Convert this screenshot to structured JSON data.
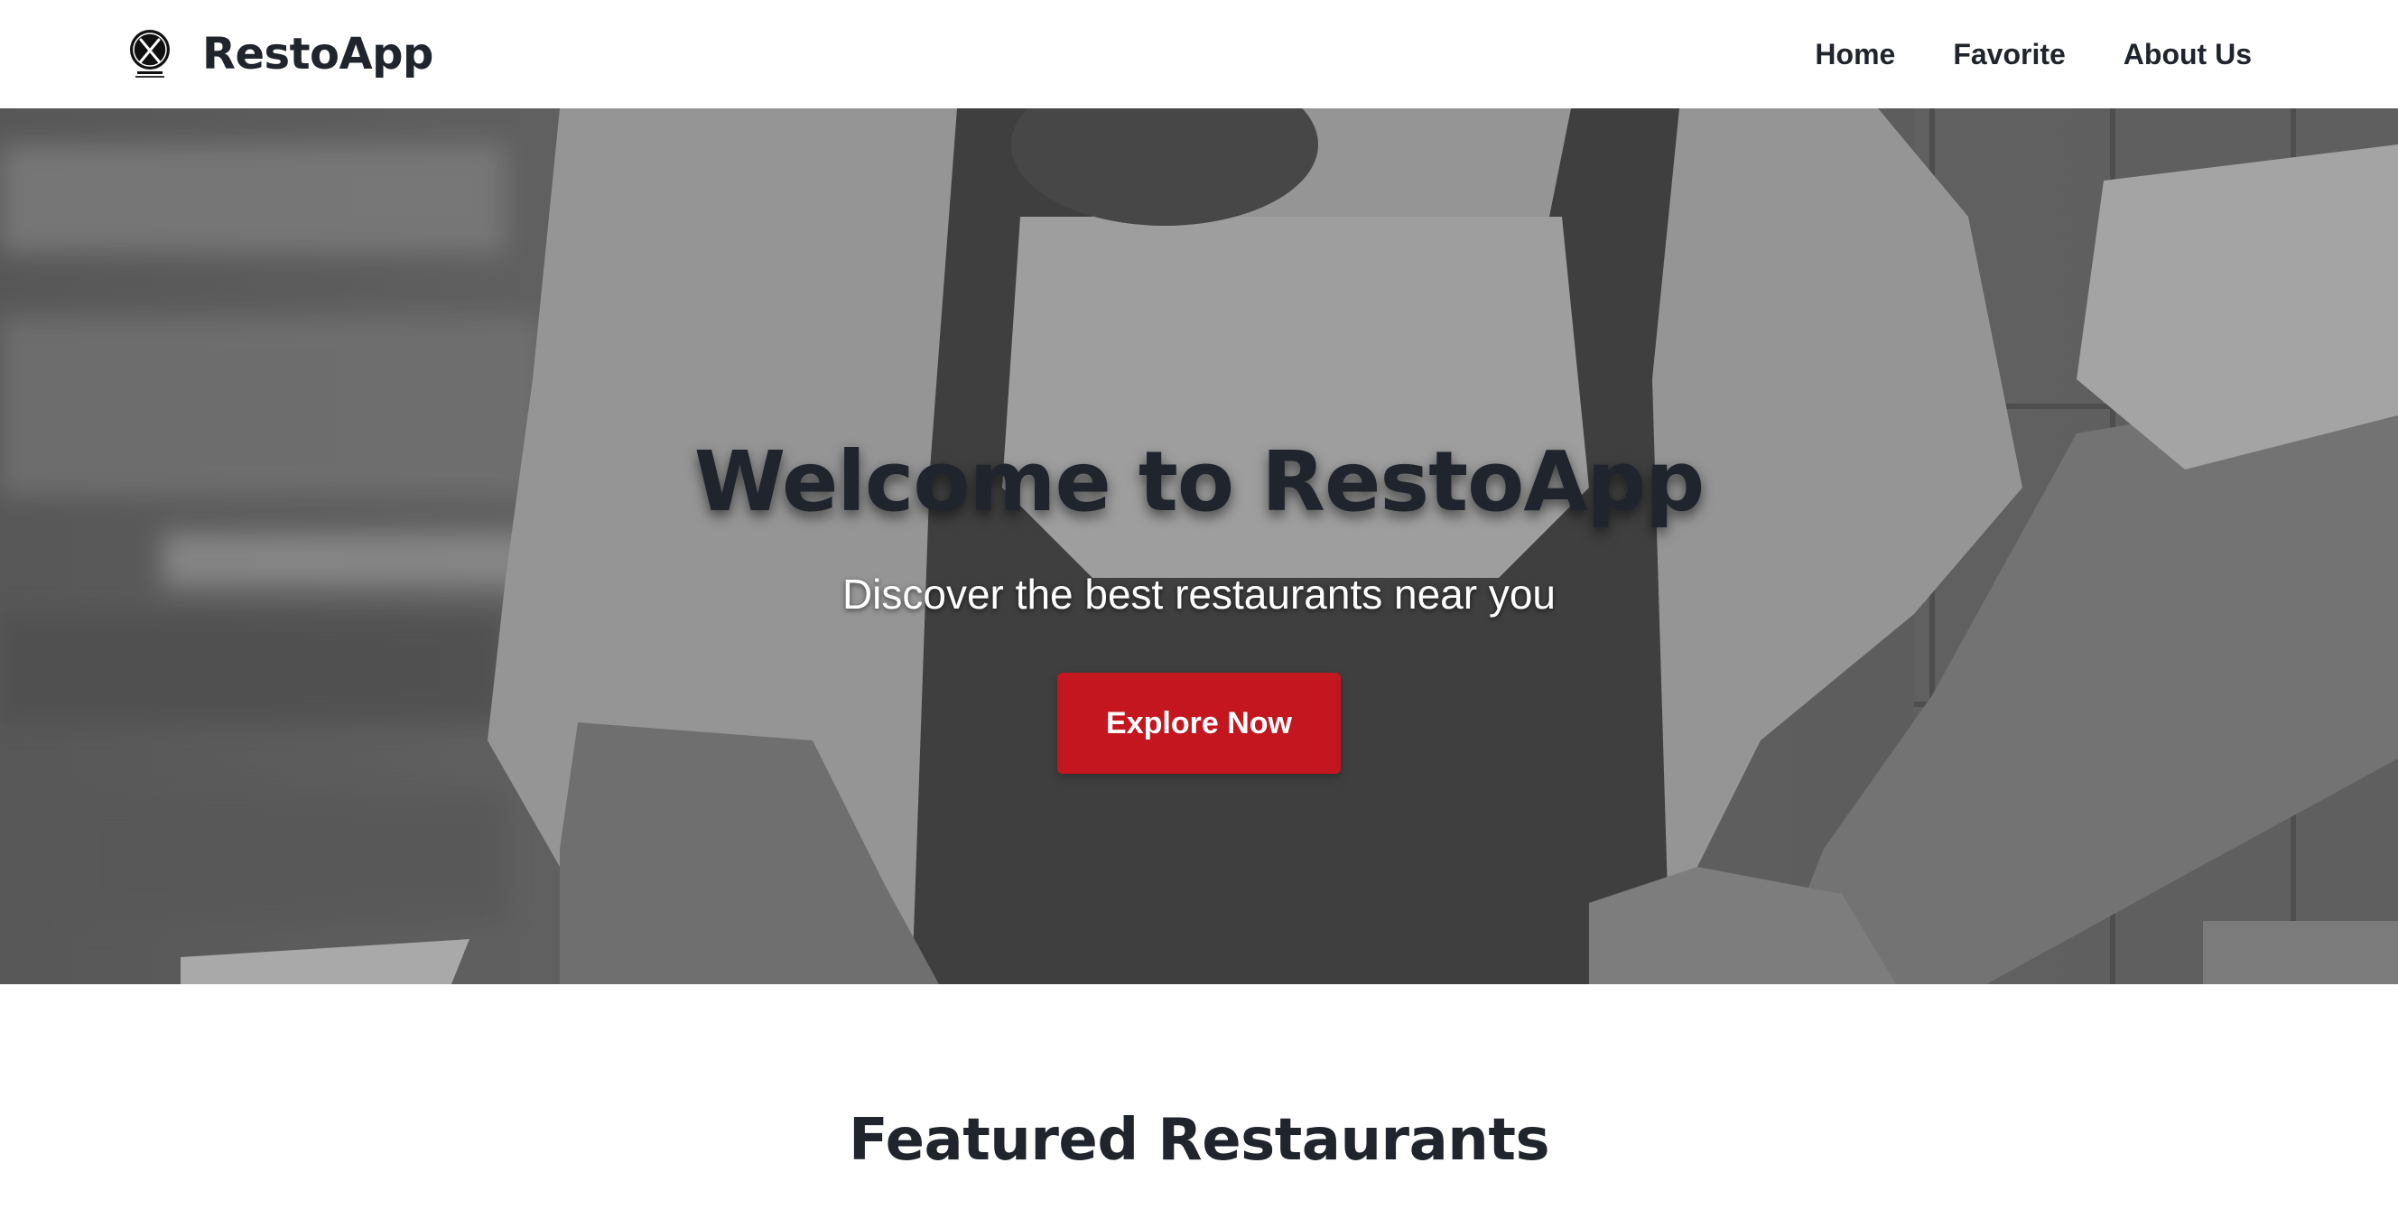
{
  "app": {
    "name": "RestoApp"
  },
  "nav": {
    "links": [
      {
        "label": "Home"
      },
      {
        "label": "Favorite"
      },
      {
        "label": "About Us"
      }
    ]
  },
  "hero": {
    "title": "Welcome to RestoApp",
    "subtitle": "Discover the best restaurants near you",
    "cta_label": "Explore Now",
    "image": "chef-in-kitchen-grayscale-photo"
  },
  "featured": {
    "title": "Featured Restaurants"
  },
  "colors": {
    "primary": "#c4161f",
    "text_dark": "#1f242d",
    "white": "#ffffff"
  },
  "icons": {
    "logo": "restaurant-logo-icon"
  }
}
